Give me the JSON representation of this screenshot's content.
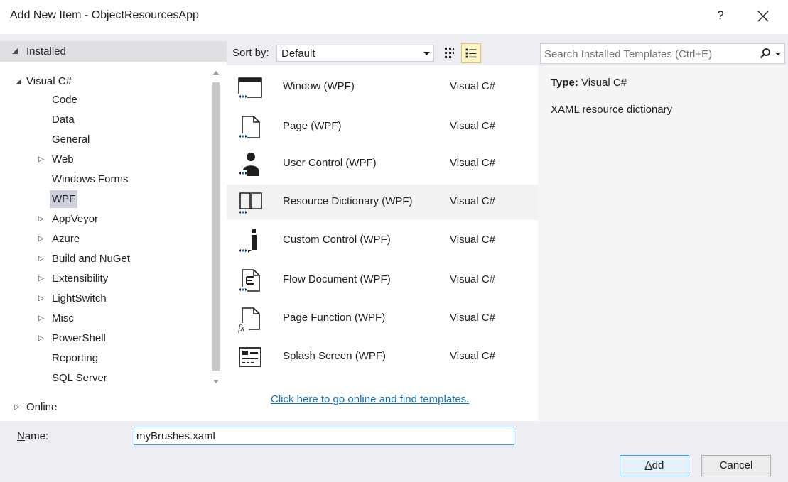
{
  "window": {
    "title": "Add New Item - ObjectResourcesApp",
    "help_label": "?"
  },
  "left": {
    "installed_label": "Installed",
    "tree": [
      {
        "label": "Visual C#",
        "expanded": true
      },
      {
        "label": "Code"
      },
      {
        "label": "Data"
      },
      {
        "label": "General"
      },
      {
        "label": "Web",
        "collapsed": true
      },
      {
        "label": "Windows Forms"
      },
      {
        "label": "WPF",
        "selected": true
      },
      {
        "label": "AppVeyor",
        "collapsed": true
      },
      {
        "label": "Azure",
        "collapsed": true
      },
      {
        "label": "Build and NuGet",
        "collapsed": true
      },
      {
        "label": "Extensibility",
        "collapsed": true
      },
      {
        "label": "LightSwitch",
        "collapsed": true
      },
      {
        "label": "Misc",
        "collapsed": true
      },
      {
        "label": "PowerShell",
        "collapsed": true
      },
      {
        "label": "Reporting"
      },
      {
        "label": "SQL Server"
      }
    ],
    "online_label": "Online"
  },
  "sort": {
    "label": "Sort by:",
    "value": "Default"
  },
  "templates": [
    {
      "name": "Window (WPF)",
      "lang": "Visual C#",
      "icon": "window-icon"
    },
    {
      "name": "Page (WPF)",
      "lang": "Visual C#",
      "icon": "page-icon"
    },
    {
      "name": "User Control (WPF)",
      "lang": "Visual C#",
      "icon": "user-control-icon"
    },
    {
      "name": "Resource Dictionary (WPF)",
      "lang": "Visual C#",
      "icon": "resource-dictionary-icon",
      "selected": true
    },
    {
      "name": "Custom Control (WPF)",
      "lang": "Visual C#",
      "icon": "custom-control-icon"
    },
    {
      "name": "Flow Document (WPF)",
      "lang": "Visual C#",
      "icon": "flow-document-icon"
    },
    {
      "name": "Page Function (WPF)",
      "lang": "Visual C#",
      "icon": "page-function-icon"
    },
    {
      "name": "Splash Screen (WPF)",
      "lang": "Visual C#",
      "icon": "splash-screen-icon"
    }
  ],
  "online_link": "Click here to go online and find templates.",
  "search": {
    "placeholder": "Search Installed Templates (Ctrl+E)"
  },
  "details": {
    "type_label": "Type:",
    "type_value": "Visual C#",
    "description": "XAML resource dictionary"
  },
  "name_field": {
    "label": "Name:",
    "value": "myBrushes.xaml"
  },
  "buttons": {
    "add": "Add",
    "cancel": "Cancel"
  },
  "colors": {
    "accent": "#3399ff",
    "link": "#0e70c0",
    "selection": "#ccd0dc"
  }
}
